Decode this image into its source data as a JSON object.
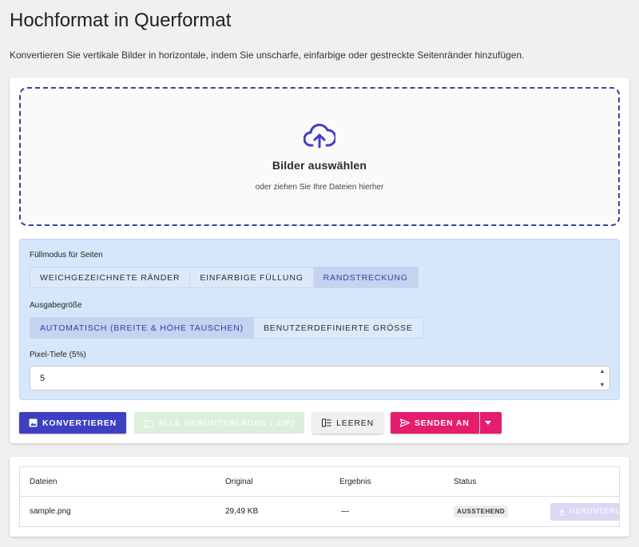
{
  "page": {
    "title": "Hochformat in Querformat",
    "description": "Konvertieren Sie vertikale Bilder in horizontale, indem Sie unscharfe, einfarbige oder gestreckte Seitenränder hinzufügen."
  },
  "dropzone": {
    "icon": "cloud-upload-icon",
    "title": "Bilder auswählen",
    "subtitle": "oder ziehen Sie Ihre Dateien hierher"
  },
  "options": {
    "fill_mode_label": "Füllmodus für Seiten",
    "fill_modes": [
      {
        "label": "WEICHGEZEICHNETE RÄNDER",
        "active": false
      },
      {
        "label": "EINFARBIGE FÜLLUNG",
        "active": false
      },
      {
        "label": "RANDSTRECKUNG",
        "active": true
      }
    ],
    "output_size_label": "Ausgabegröße",
    "output_sizes": [
      {
        "label": "AUTOMATISCH (BREITE & HÖHE TAUSCHEN)",
        "active": true
      },
      {
        "label": "BENUTZERDEFINIERTE GRÖSSE",
        "active": false
      }
    ],
    "pixel_depth_label": "Pixel-Tiefe (5%)",
    "pixel_depth_value": "5"
  },
  "actions": {
    "convert_label": "KONVERTIEREN",
    "download_all_label": "ALLE HERUNTERLADEN (.ZIP)",
    "clear_label": "LEEREN",
    "send_label": "SENDEN AN"
  },
  "files_table": {
    "headers": [
      "Dateien",
      "Original",
      "Ergebnis",
      "Status"
    ],
    "rows": [
      {
        "name": "sample.png",
        "original": "29,49 KB",
        "result": "—",
        "status": "AUSSTEHEND",
        "download_label": "HERUNTERLADEN"
      }
    ]
  },
  "colors": {
    "accent": "#3f3fc4",
    "send": "#e41d6e",
    "options_bg": "#d6e7fb"
  }
}
